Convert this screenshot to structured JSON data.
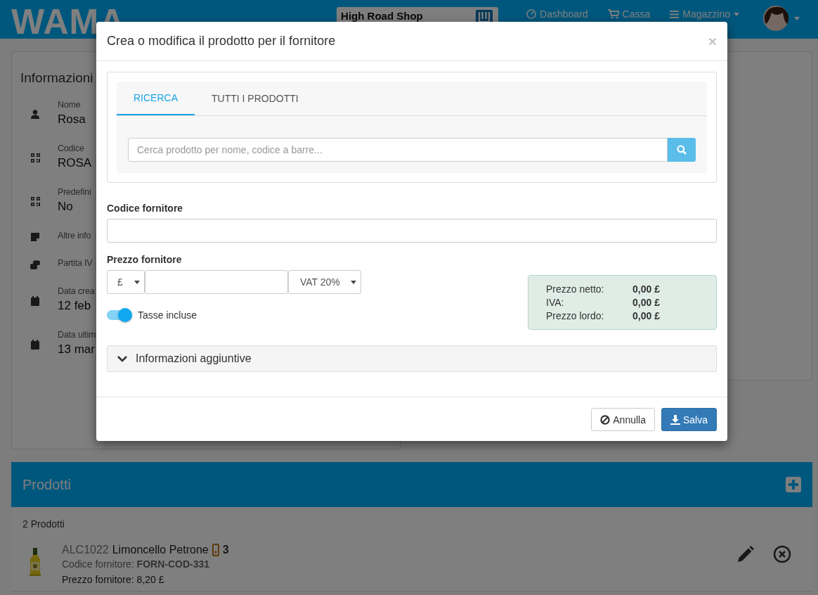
{
  "navbar": {
    "logo": "WAMA",
    "shop": "High Road Shop",
    "links": [
      {
        "kind": "dashboard",
        "label": "Dashboard",
        "dropdown": false
      },
      {
        "kind": "cart",
        "label": "Cassa",
        "dropdown": false
      },
      {
        "kind": "menu",
        "label": "Magazzino",
        "dropdown": true
      }
    ]
  },
  "info_card": {
    "title": "Informazioni",
    "fields": [
      {
        "kind": "person",
        "label": "Nome",
        "value": "Rosa"
      },
      {
        "kind": "qr",
        "label": "Codice",
        "value": "ROSA"
      },
      {
        "kind": "qr",
        "label": "Predefini",
        "value": "No"
      },
      {
        "kind": "note",
        "label": "Altre info"
      },
      {
        "kind": "coins",
        "label": "Partita IV"
      },
      {
        "kind": "calendar",
        "label": "Data crea",
        "value": "12 feb"
      },
      {
        "kind": "calendar",
        "label": "Data ultim",
        "value": "13 mar"
      }
    ]
  },
  "modal": {
    "title": "Crea o modifica il prodotto per il fornitore",
    "close": "×",
    "tabs": [
      {
        "label": "RICERCA",
        "selected": true
      },
      {
        "label": "TUTTI I PRODOTTI",
        "selected": false
      }
    ],
    "search": {
      "placeholder": "Cerca prodotto per nome, codice a barre..."
    },
    "supplier_code": {
      "label": "Codice fornitore"
    },
    "supplier_price": {
      "label": "Prezzo fornitore",
      "currency": "£",
      "vat": "VAT 20%"
    },
    "tax_toggle": {
      "label": "Tasse incluse",
      "on": true
    },
    "summary": [
      {
        "label": "Prezzo netto:",
        "value": "0,00 £"
      },
      {
        "label": "IVA:",
        "value": "0,00 £"
      },
      {
        "label": "Prezzo lordo:",
        "value": "0,00 £"
      }
    ],
    "extra": {
      "label": "Informazioni aggiuntive",
      "expanded": false
    },
    "buttons": [
      {
        "kind": "cancel",
        "label": "Annulla"
      },
      {
        "kind": "save",
        "label": "Salva"
      }
    ]
  },
  "products": {
    "title": "Prodotti",
    "count": "2 Prodotti",
    "items": [
      {
        "code": "ALC1022",
        "name": "Limoncello Petrone",
        "quantity": "3",
        "supplier_code": "Codice fornitore: **FORN-COD-331**",
        "supplier_price": "Prezzo fornitore: 8,20 £"
      }
    ]
  }
}
